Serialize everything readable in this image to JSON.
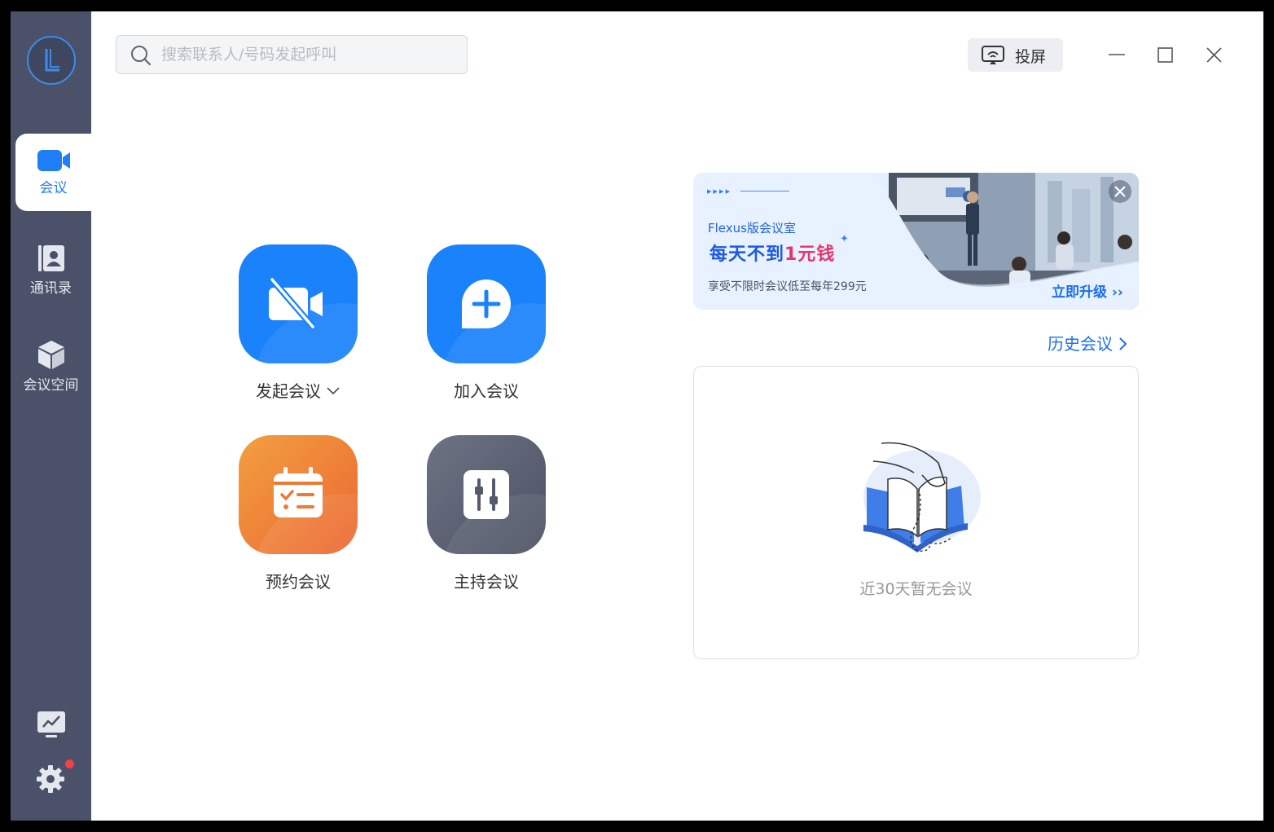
{
  "sidebar": {
    "items": [
      {
        "label": "会议",
        "active": true
      },
      {
        "label": "通讯录",
        "active": false
      },
      {
        "label": "会议空间",
        "active": false
      }
    ],
    "settings_has_notification": true
  },
  "search": {
    "placeholder": "搜索联系人/号码发起呼叫",
    "value": ""
  },
  "toolbar": {
    "cast_label": "投屏"
  },
  "actions": {
    "start": "发起会议",
    "join": "加入会议",
    "schedule": "预约会议",
    "host": "主持会议"
  },
  "banner": {
    "product": "Flexus版会议室",
    "headline_prefix": "每天不到",
    "headline_accent": "1元钱",
    "subtitle": "享受不限时会议低至每年299元",
    "cta": "立即升级 ››"
  },
  "history": {
    "link_label": "历史会议",
    "empty_text": "近30天暂无会议"
  },
  "colors": {
    "sidebar": "#4a5168",
    "accent": "#1a82fb",
    "orange": "#ec6632",
    "notification": "#f4404a"
  }
}
